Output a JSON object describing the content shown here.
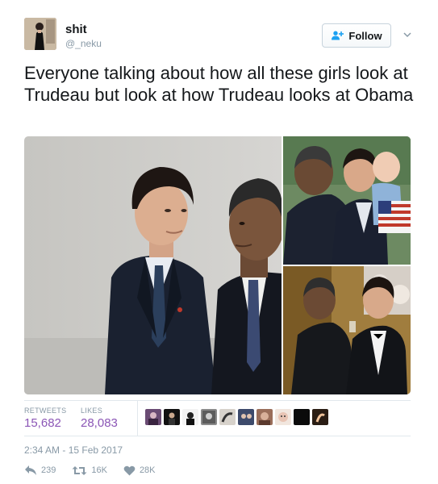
{
  "user": {
    "display_name": "shit",
    "handle": "@_neku"
  },
  "follow_button": {
    "label": "Follow"
  },
  "tweet": {
    "text": "Everyone talking about how all these girls look at Trudeau but look at how Trudeau looks at Obama"
  },
  "stats": {
    "retweets_label": "RETWEETS",
    "retweets_value": "15,682",
    "likes_label": "LIKES",
    "likes_value": "28,083"
  },
  "timestamp": "2:34 AM - 15 Feb 2017",
  "actions": {
    "reply_count": "239",
    "retweet_count": "16K",
    "like_count": "28K"
  },
  "colors": {
    "stat_value": "#8b56b6",
    "follow_icon": "#1da1f2",
    "muted": "#8899a6"
  },
  "icons": {
    "reply": "reply-icon",
    "retweet": "retweet-icon",
    "like": "heart-icon",
    "follow": "add-user-icon",
    "more": "chevron-down-icon"
  }
}
